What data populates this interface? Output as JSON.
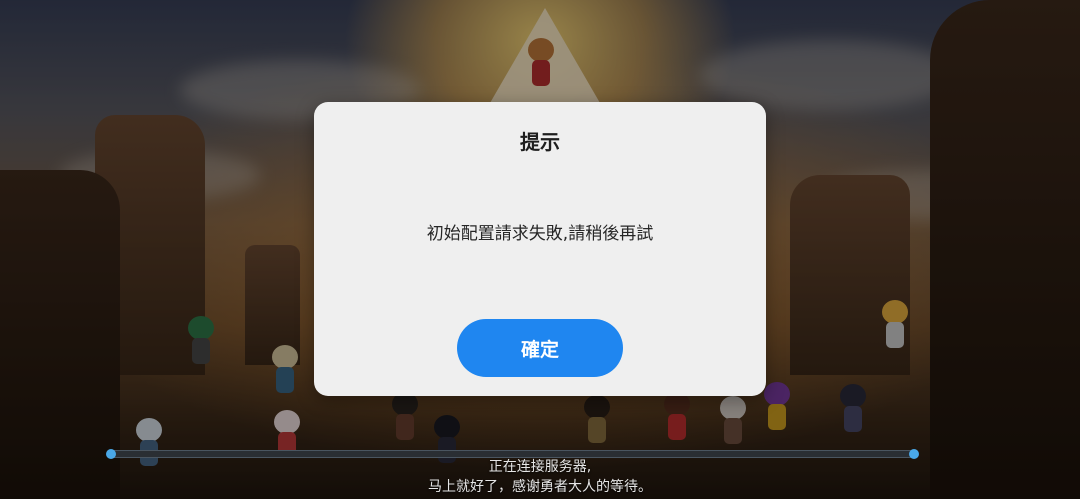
{
  "dialog": {
    "title": "提示",
    "message": "初始配置請求失敗,請稍後再試",
    "confirm_label": "確定"
  },
  "loading": {
    "line1": "正在连接服务器,",
    "line2": "马上就好了，感谢勇者大人的等待。",
    "progress": 0
  },
  "colors": {
    "button": "#1f86f0",
    "dialog_bg": "#efefef",
    "progress_accent": "#4aa8e8"
  }
}
